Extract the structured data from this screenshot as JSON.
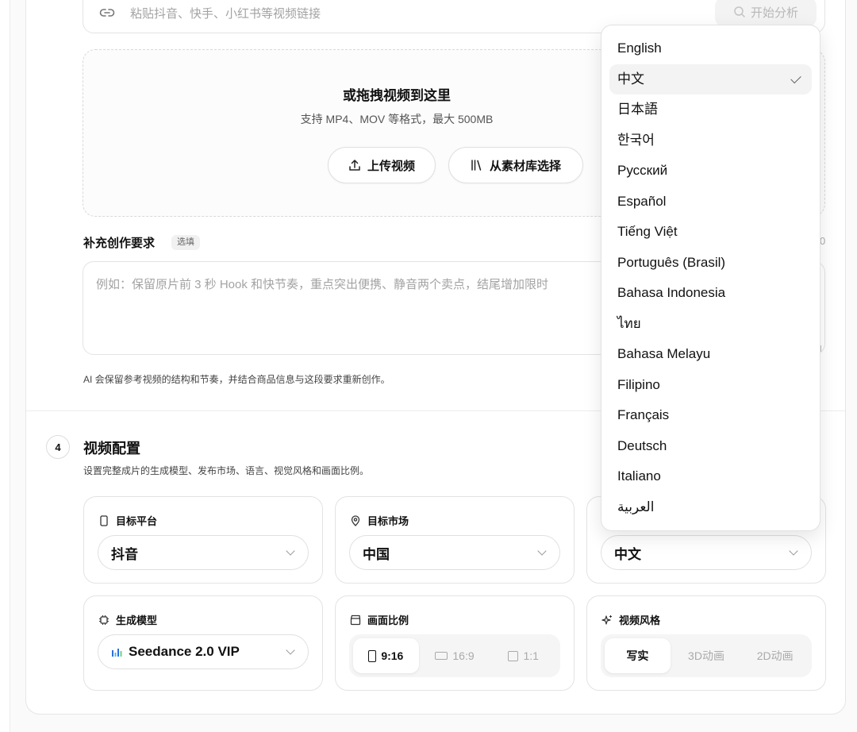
{
  "url_input": {
    "placeholder": "粘贴抖音、快手、小红书等视频链接",
    "analyze_label": "开始分析"
  },
  "dropzone": {
    "title": "或拖拽视频到这里",
    "subtitle": "支持 MP4、MOV 等格式，最大 500MB",
    "upload_label": "上传视频",
    "library_label": "从素材库选择"
  },
  "requirements": {
    "label": "补充创作要求",
    "optional_tag": "选填",
    "counter": "0",
    "placeholder": "例如：保留原片前 3 秒 Hook 和快节奏，重点突出便携、静音两个卖点，结尾增加限时",
    "hint": "AI 会保留参考视频的结构和节奏，并结合商品信息与这段要求重新创作。"
  },
  "video_config": {
    "step": "4",
    "title": "视频配置",
    "subtitle": "设置完整成片的生成模型、发布市场、语言、视觉风格和画面比例。",
    "platform": {
      "label": "目标平台",
      "value": "抖音"
    },
    "market": {
      "label": "目标市场",
      "value": "中国"
    },
    "language": {
      "value": "中文"
    },
    "model": {
      "label": "生成模型",
      "value": "Seedance 2.0 VIP"
    },
    "ratio": {
      "label": "画面比例",
      "options": [
        "9:16",
        "16:9",
        "1:1"
      ],
      "selected": "9:16"
    },
    "style": {
      "label": "视频风格",
      "options": [
        "写实",
        "3D动画",
        "2D动画"
      ],
      "selected": "写实"
    }
  },
  "language_dropdown": {
    "selected": "中文",
    "items": [
      "English",
      "中文",
      "日本語",
      "한국어",
      "Русский",
      "Español",
      "Tiếng Việt",
      "Português (Brasil)",
      "Bahasa Indonesia",
      "ไทย",
      "Bahasa Melayu",
      "Filipino",
      "Français",
      "Deutsch",
      "Italiano",
      "العربية"
    ]
  }
}
